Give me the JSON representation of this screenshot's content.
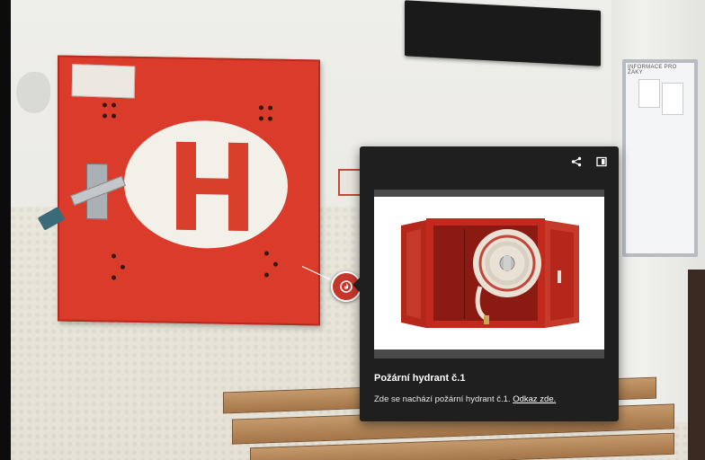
{
  "hotspot": {
    "icon": "fire-icon",
    "color": "#c7362a"
  },
  "card": {
    "title": "Požární hydrant č.1",
    "description_prefix": "Zde se nachází požární hydrant č.1.",
    "link_text": "Odkaz zde.",
    "background": "#1f1f1f",
    "toolbar": {
      "share_icon": "share-icon",
      "expand_icon": "panel-expand-icon"
    }
  },
  "scene": {
    "notice_board_header": "INFORMACE PRO ŽÁKY",
    "hydrant_sign_letter": "H"
  }
}
